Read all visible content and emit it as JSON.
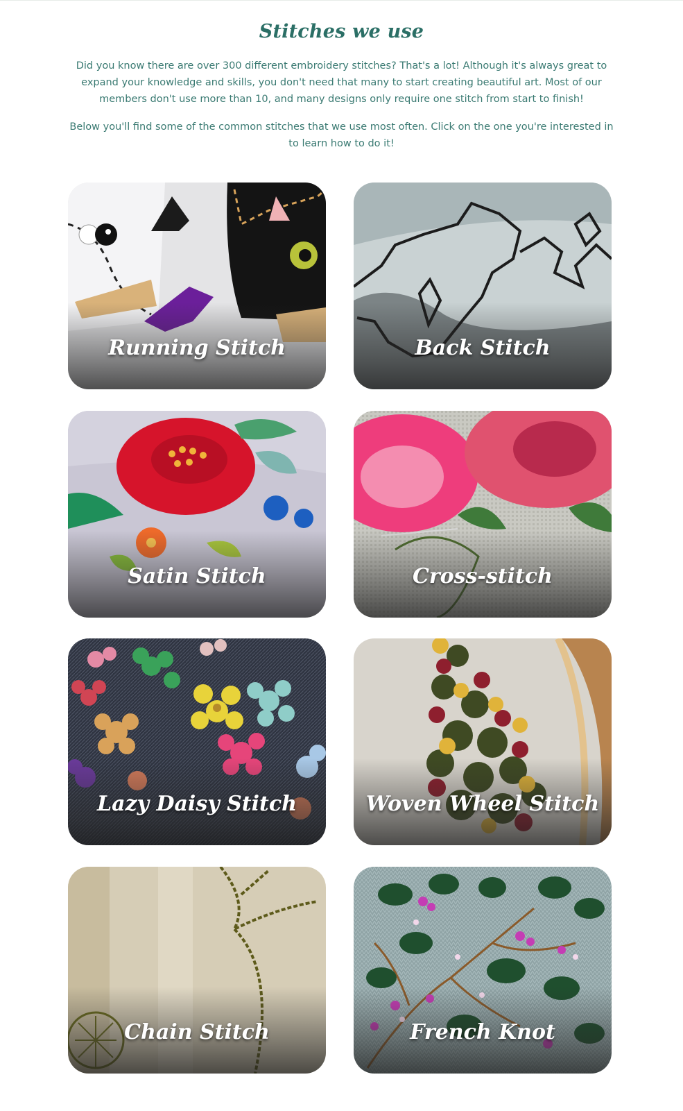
{
  "section": {
    "title": "Stitches we use",
    "intro": "Did you know there are over 300 different embroidery stitches? That's a lot! Although it's always great to expand your knowledge and skills, you don't need that many to start creating beautiful art. Most of our members don't use more than 10, and many designs only require one stitch from start to finish!",
    "intro_2": "Below you'll find some of the common stitches that we use most often. Click on the one you're interested in to learn how to do it!"
  },
  "stitches": [
    {
      "label": "Running Stitch"
    },
    {
      "label": "Back Stitch"
    },
    {
      "label": "Satin Stitch"
    },
    {
      "label": "Cross-stitch"
    },
    {
      "label": "Lazy Daisy Stitch"
    },
    {
      "label": "Woven Wheel Stitch"
    },
    {
      "label": "Chain Stitch"
    },
    {
      "label": "French Knot"
    }
  ],
  "colors": {
    "title": "#2b6f66",
    "body_text": "#3a7a72",
    "card_label": "#ffffff"
  }
}
